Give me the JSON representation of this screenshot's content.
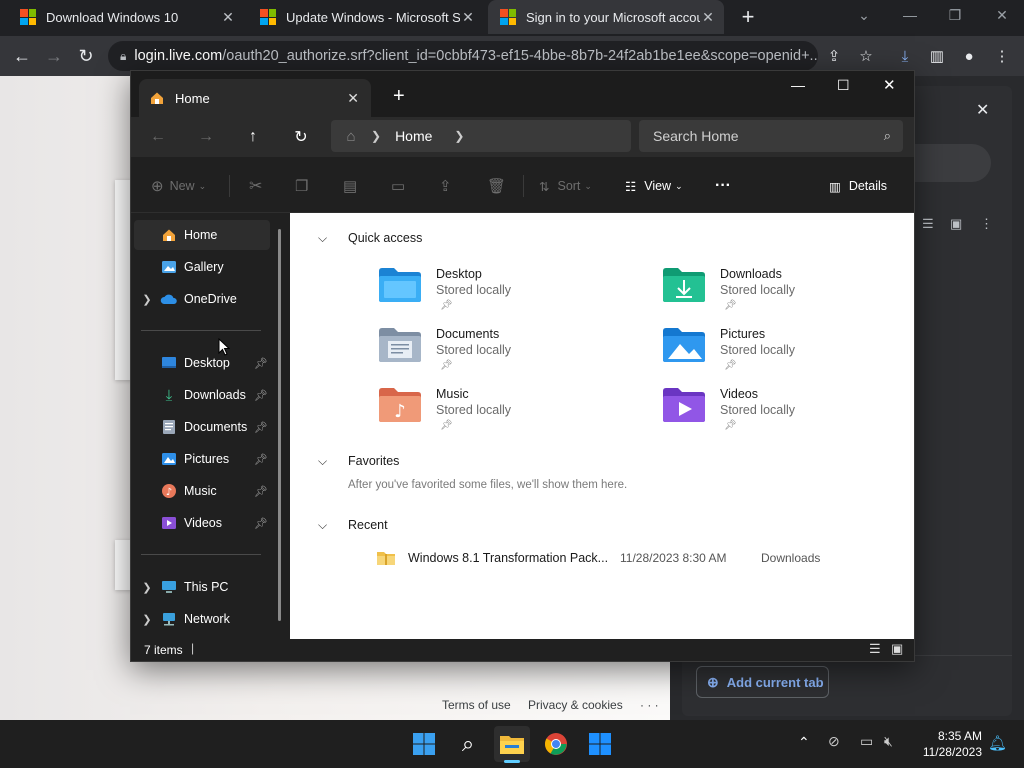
{
  "browser": {
    "tabs": [
      {
        "title": "Download Windows 10",
        "close": "✕"
      },
      {
        "title": "Update Windows - Microsoft Support",
        "close": "✕"
      },
      {
        "title": "Sign in to your Microsoft account",
        "close": "✕"
      }
    ],
    "new_tab": "+",
    "url_host": "login.live.com",
    "url_rest": "/oauth20_authorize.srf?client_id=0cbbf473-ef15-4bbe-8b7b-24f2ab1be1ee&scope=openid+...",
    "colors": {
      "ms_red": "#f25022",
      "ms_green": "#7fba00",
      "ms_blue": "#00a4ef",
      "ms_yellow": "#ffb900"
    }
  },
  "page": {
    "footer_links": [
      "Terms of use",
      "Privacy & cookies",
      "· · ·"
    ],
    "side_panel": {
      "close": "✕",
      "add_button": "Add current tab"
    }
  },
  "explorer": {
    "tab_title": "Home",
    "address": {
      "crumb": "Home"
    },
    "search_placeholder": "Search Home",
    "commands": {
      "new": "New",
      "sort": "Sort",
      "view": "View",
      "more": "···",
      "details": "Details"
    },
    "sidebar": {
      "top": [
        {
          "label": "Home",
          "icon": "home-icon",
          "selected": true
        },
        {
          "label": "Gallery",
          "icon": "gallery-icon"
        },
        {
          "label": "OneDrive",
          "icon": "onedrive-icon",
          "expandable": true
        }
      ],
      "pinned": [
        {
          "label": "Desktop",
          "icon": "desktop-icon"
        },
        {
          "label": "Downloads",
          "icon": "downloads-icon"
        },
        {
          "label": "Documents",
          "icon": "documents-icon"
        },
        {
          "label": "Pictures",
          "icon": "pictures-icon"
        },
        {
          "label": "Music",
          "icon": "music-icon"
        },
        {
          "label": "Videos",
          "icon": "videos-icon"
        }
      ],
      "bottom": [
        {
          "label": "This PC",
          "icon": "this-pc-icon"
        },
        {
          "label": "Network",
          "icon": "network-icon"
        }
      ]
    },
    "quick_access": {
      "heading": "Quick access",
      "items": [
        {
          "name": "Desktop",
          "sub": "Stored locally"
        },
        {
          "name": "Downloads",
          "sub": "Stored locally"
        },
        {
          "name": "Documents",
          "sub": "Stored locally"
        },
        {
          "name": "Pictures",
          "sub": "Stored locally"
        },
        {
          "name": "Music",
          "sub": "Stored locally"
        },
        {
          "name": "Videos",
          "sub": "Stored locally"
        }
      ]
    },
    "favorites": {
      "heading": "Favorites",
      "empty": "After you've favorited some files, we'll show them here."
    },
    "recent": {
      "heading": "Recent",
      "items": [
        {
          "name": "Windows 8.1 Transformation Pack...",
          "date": "11/28/2023 8:30 AM",
          "location": "Downloads"
        }
      ]
    },
    "status": {
      "count": "7 items"
    }
  },
  "taskbar": {
    "time": "8:35 AM",
    "date": "11/28/2023"
  }
}
